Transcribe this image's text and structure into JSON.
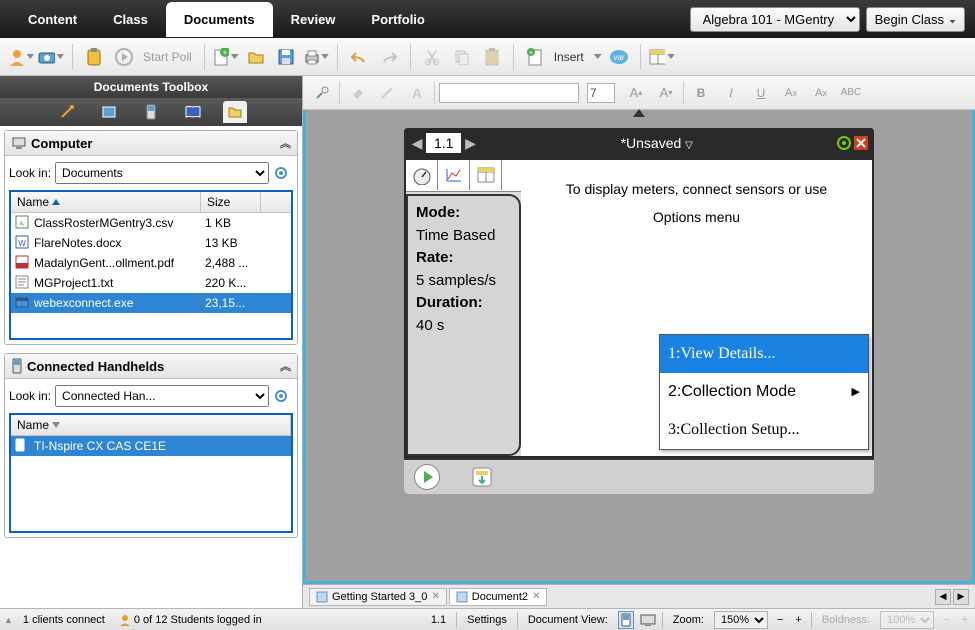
{
  "topnav": {
    "tabs": [
      "Content",
      "Class",
      "Documents",
      "Review",
      "Portfolio"
    ],
    "active_tab": 2,
    "class_selector": "Algebra 101 - MGentry",
    "begin_class_label": "Begin Class"
  },
  "toolbar": {
    "start_poll_label": "Start Poll",
    "insert_label": "Insert"
  },
  "toolbox": {
    "title": "Documents Toolbox"
  },
  "computer_panel": {
    "title": "Computer",
    "lookin_label": "Look in:",
    "lookin_value": "Documents",
    "columns": {
      "name": "Name",
      "size": "Size"
    },
    "files": [
      {
        "name": "ClassRosterMGentry3.csv",
        "size": "1 KB",
        "icon": "csv"
      },
      {
        "name": "FlareNotes.docx",
        "size": "13 KB",
        "icon": "docx"
      },
      {
        "name": "MadalynGent...ollment.pdf",
        "size": "2,488 ...",
        "icon": "pdf"
      },
      {
        "name": "MGProject1.txt",
        "size": "220 K...",
        "icon": "txt"
      },
      {
        "name": "webexconnect.exe",
        "size": "23,15...",
        "icon": "exe",
        "selected": true
      }
    ]
  },
  "handheld_panel": {
    "title": "Connected Handhelds",
    "lookin_label": "Look in:",
    "lookin_value": "Connected Han...",
    "columns": {
      "name": "Name"
    },
    "devices": [
      {
        "name": "TI-Nspire CX CAS CE1E",
        "selected": true
      }
    ]
  },
  "fmt": {
    "font_name": "",
    "font_size": "7"
  },
  "device": {
    "page_num": "1.1",
    "title": "*Unsaved",
    "info": {
      "mode_label": "Mode:",
      "mode_value": "Time Based",
      "rate_label": "Rate:",
      "rate_value": "5 samples/s",
      "duration_label": "Duration:",
      "duration_value": "40 s"
    },
    "message_line1": "To display meters, connect sensors or use",
    "message_line2": "Options menu",
    "menu": [
      {
        "label": "1:View Details...",
        "highlighted": true
      },
      {
        "label": "2:Collection Mode",
        "submenu": true
      },
      {
        "label": "3:Collection Setup..."
      }
    ]
  },
  "doc_tabs": [
    {
      "label": "Getting Started 3_0"
    },
    {
      "label": "Document2",
      "active": true
    }
  ],
  "statusbar": {
    "clients": "1 clients connect",
    "students": "0 of 12 Students logged in",
    "page": "1.1",
    "settings_label": "Settings",
    "doc_view_label": "Document View:",
    "zoom_label": "Zoom:",
    "zoom_value": "150%",
    "boldness_label": "Boldness:",
    "boldness_value": "100%"
  }
}
